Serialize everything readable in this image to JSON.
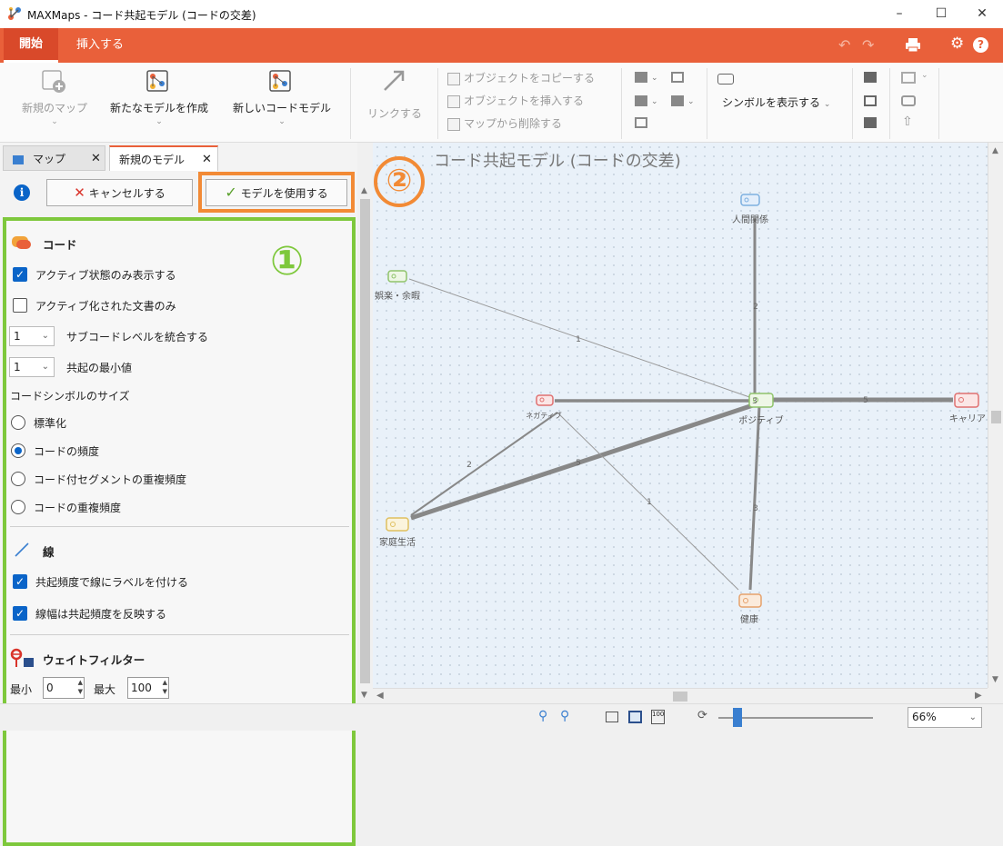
{
  "window": {
    "title": "MAXMaps - コード共起モデル (コードの交差)"
  },
  "ribbon_tabs": {
    "start": "開始",
    "insert": "挿入する"
  },
  "ribbon": {
    "new_map": "新規のマップ",
    "new_model": "新たなモデルを作成",
    "new_code_model": "新しいコードモデル",
    "link": "リンクする",
    "copy_object": "オブジェクトをコピーする",
    "insert_object": "オブジェクトを挿入する",
    "delete_from_map": "マップから削除する",
    "show_symbol": "シンボルを表示する"
  },
  "panel": {
    "tabs": {
      "map": "マップ",
      "new_model": "新規のモデル"
    },
    "cancel": "キャンセルする",
    "use_model": "モデルを使用する",
    "markers": {
      "one": "①",
      "two": "②"
    },
    "code_section": {
      "title": "コード",
      "active_only": "アクティブ状態のみ表示する",
      "active_docs_only": "アクティブ化された文書のみ",
      "subcode_level_value": "1",
      "subcode_level_label": "サブコードレベルを統合する",
      "min_cooccur_value": "1",
      "min_cooccur_label": "共起の最小値",
      "symbol_size_label": "コードシンボルのサイズ",
      "opt_standard": "標準化",
      "opt_code_freq": "コードの頻度",
      "opt_segment_freq": "コード付セグメントの重複頻度",
      "opt_overlap_freq": "コードの重複頻度"
    },
    "line_section": {
      "title": "線",
      "label_lines": "共起頻度で線にラベルを付ける",
      "width_reflects": "線幅は共起頻度を反映する"
    },
    "weight_section": {
      "title": "ウェイトフィルター",
      "min_label": "最小",
      "min_value": "0",
      "max_label": "最大",
      "max_value": "100"
    }
  },
  "canvas": {
    "title": "コード共起モデル (コードの交差)",
    "nodes": {
      "ningen": "人間関係",
      "goraku": "娯楽・余暇",
      "negative": "ネガティブ",
      "positive": "ポジティブ",
      "career": "キャリア",
      "katei": "家庭生活",
      "kenko": "健康"
    },
    "edge_labels": {
      "ningen_positive": "2",
      "goraku_positive": "1",
      "negative_positive": "3",
      "positive_career": "5",
      "negative_katei": "2",
      "katei_positive": "5",
      "negative_kenko": "1",
      "positive_kenko": "3"
    }
  },
  "status": {
    "zoom": "66%"
  },
  "colors": {
    "accent": "#e9603a",
    "highlight_green": "#7ec83c",
    "highlight_orange": "#f28a35"
  }
}
